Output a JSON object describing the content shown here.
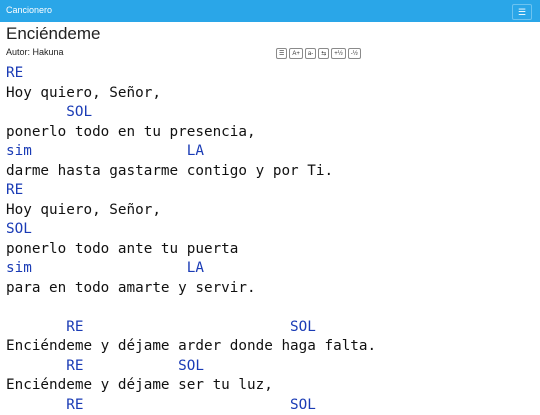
{
  "navbar": {
    "brand": "Cancionero",
    "menu_icon": "hamburger-icon"
  },
  "song": {
    "title": "Enciéndeme",
    "author": "Autor: Hakuna",
    "tools": [
      "☰",
      "A+",
      "a-",
      "⇆",
      "+½",
      "-½"
    ],
    "lines": [
      {
        "type": "chord",
        "text": "RE"
      },
      {
        "type": "lyric",
        "text": "Hoy quiero, Señor,"
      },
      {
        "type": "chord",
        "text": "       SOL"
      },
      {
        "type": "lyric",
        "text": "ponerlo todo en tu presencia,"
      },
      {
        "type": "chord",
        "text": "sim                  LA"
      },
      {
        "type": "lyric",
        "text": "darme hasta gastarme contigo y por Ti."
      },
      {
        "type": "chord",
        "text": "RE"
      },
      {
        "type": "lyric",
        "text": "Hoy quiero, Señor,"
      },
      {
        "type": "chord",
        "text": "SOL"
      },
      {
        "type": "lyric",
        "text": "ponerlo todo ante tu puerta"
      },
      {
        "type": "chord",
        "text": "sim                  LA"
      },
      {
        "type": "lyric",
        "text": "para en todo amarte y servir."
      },
      {
        "type": "blank",
        "text": ""
      },
      {
        "type": "chord",
        "text": "       RE                        SOL"
      },
      {
        "type": "lyric",
        "text": "Enciéndeme y déjame arder donde haga falta."
      },
      {
        "type": "chord",
        "text": "       RE           SOL"
      },
      {
        "type": "lyric",
        "text": "Enciéndeme y déjame ser tu luz,"
      },
      {
        "type": "chord",
        "text": "       RE                        SOL"
      }
    ]
  }
}
